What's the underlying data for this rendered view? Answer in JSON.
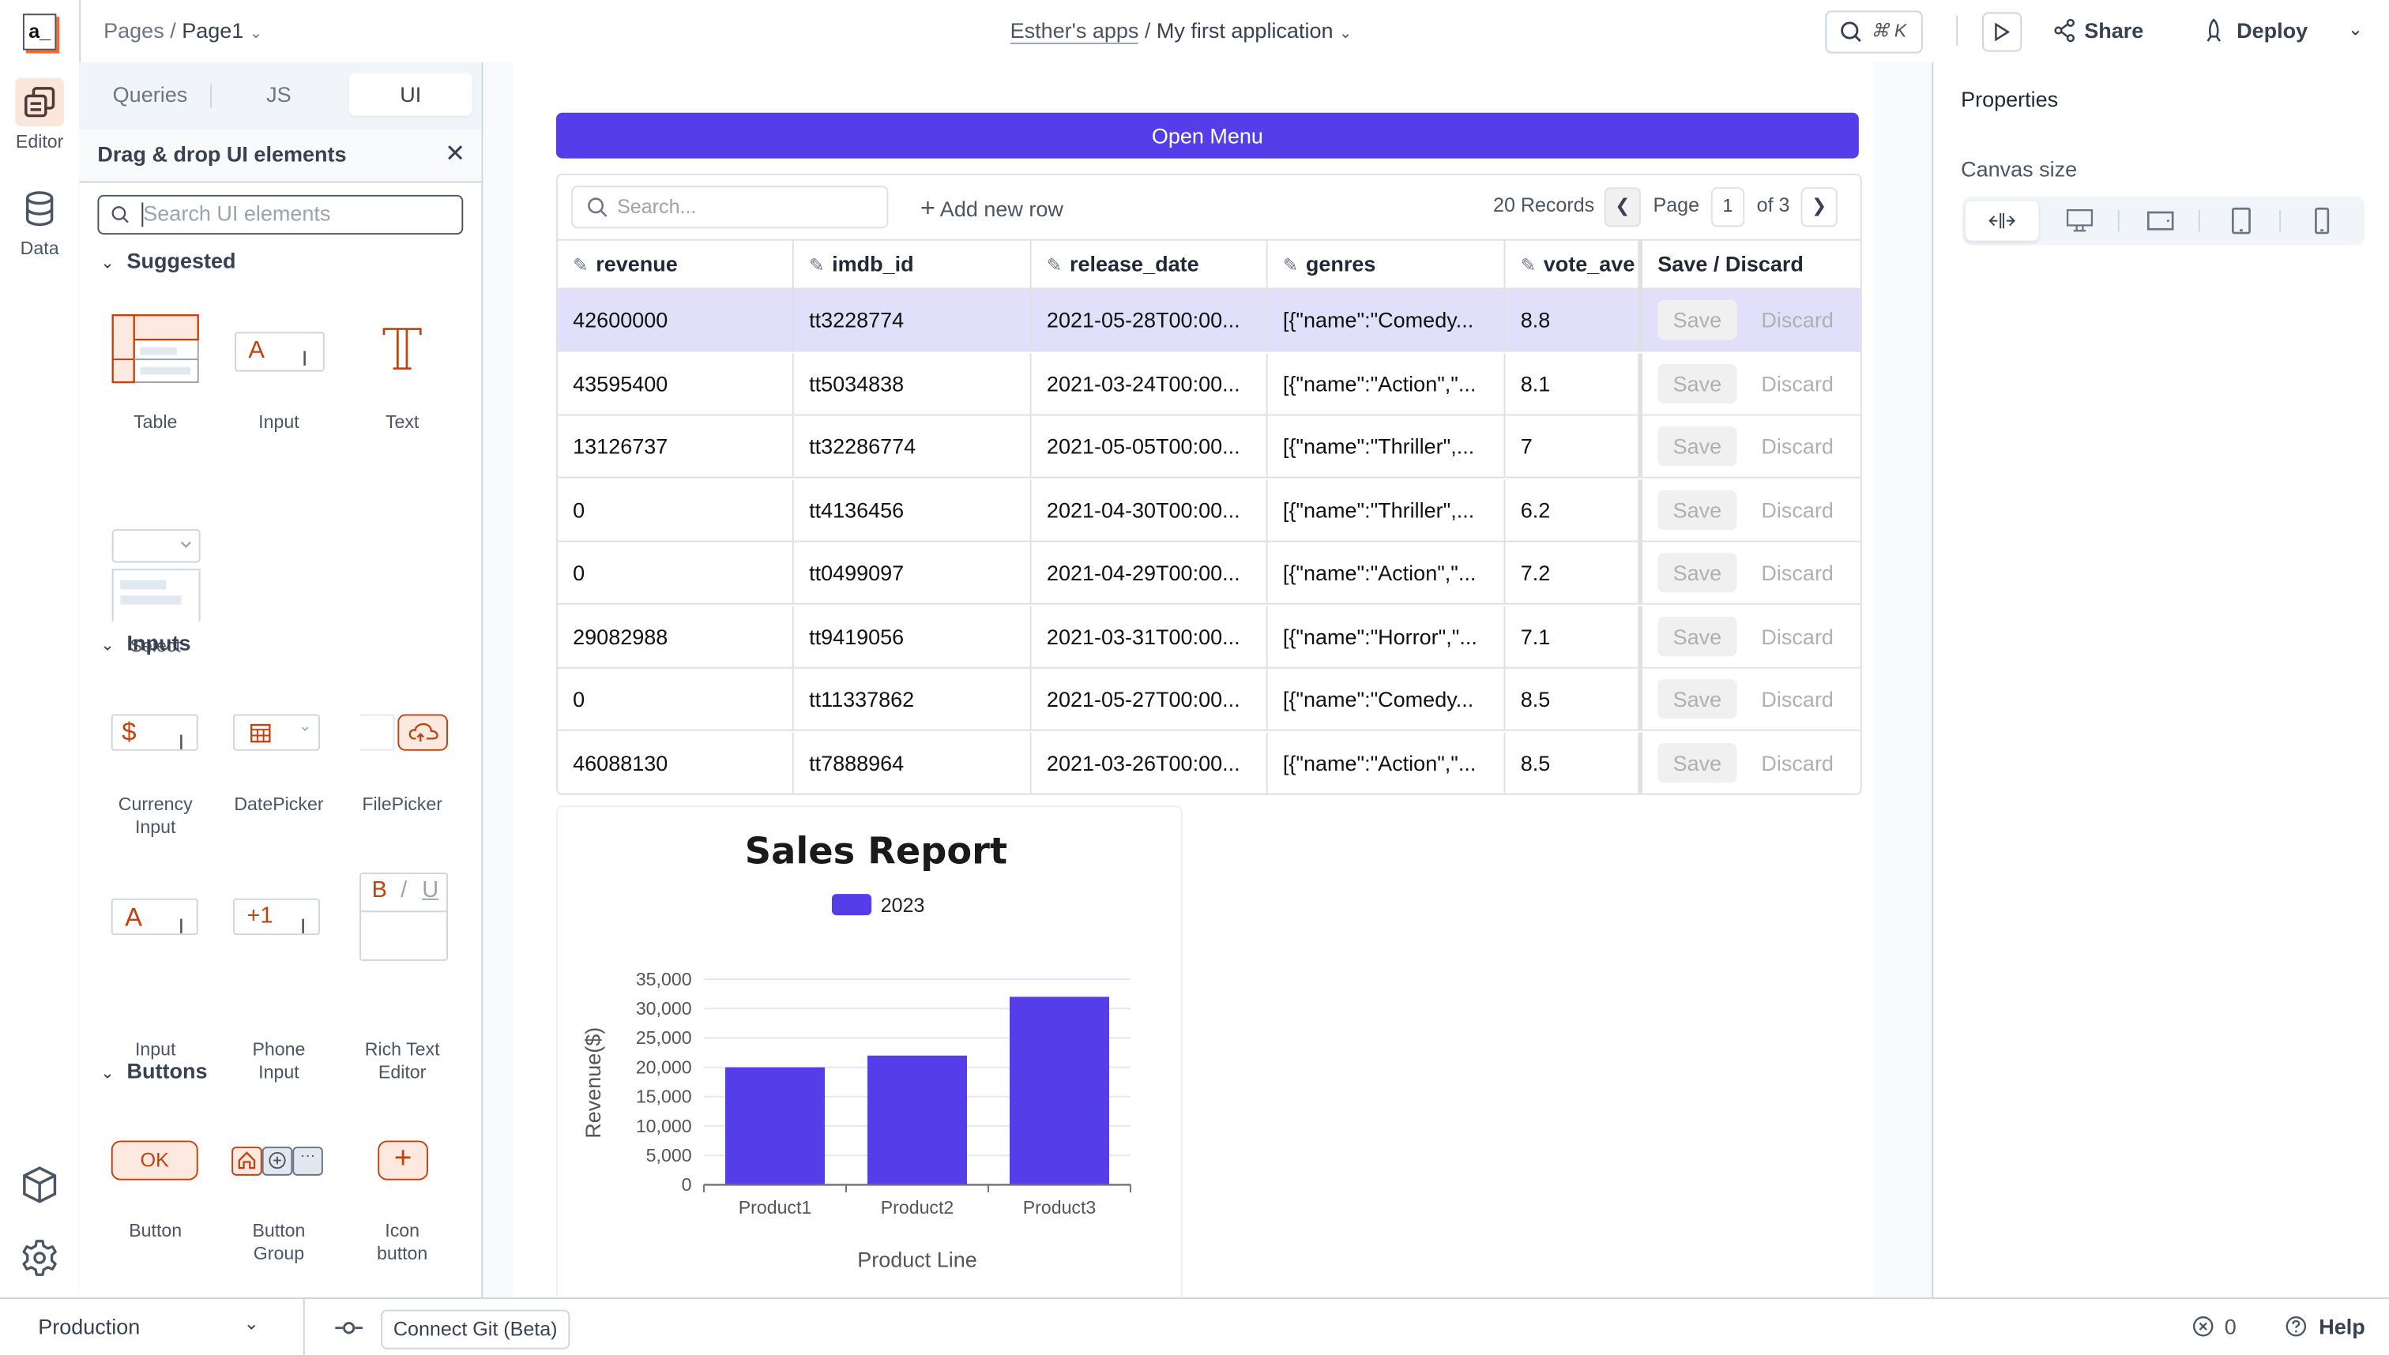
{
  "header": {
    "logo": "a_",
    "breadcrumb_root": "Pages",
    "breadcrumb_sep": "/",
    "page_name": "Page1",
    "workspace": "Esther's apps",
    "app_sep": "/",
    "app_name": "My first application",
    "search_shortcut": "⌘ K",
    "share_label": "Share",
    "deploy_label": "Deploy"
  },
  "rail": {
    "editor_label": "Editor",
    "data_label": "Data"
  },
  "explorer": {
    "tabs": [
      {
        "label": "Queries",
        "active": false
      },
      {
        "label": "JS",
        "active": false
      },
      {
        "label": "UI",
        "active": true
      }
    ],
    "panel_title": "Drag & drop UI elements",
    "search_placeholder": "Search UI elements",
    "sections": [
      {
        "title": "Suggested",
        "items": [
          "Table",
          "Input",
          "Text",
          "Select"
        ]
      },
      {
        "title": "Inputs",
        "items": [
          "Currency Input",
          "DatePicker",
          "FilePicker",
          "Input",
          "Phone Input",
          "Rich Text Editor"
        ]
      },
      {
        "title": "Buttons",
        "items": [
          "Button",
          "Button Group",
          "Icon button"
        ]
      }
    ],
    "labels": {
      "currency_1": "Currency",
      "currency_2": "Input",
      "phone_1": "Phone",
      "phone_2": "Input",
      "rte_1": "Rich Text",
      "rte_2": "Editor",
      "bgroup_1": "Button",
      "bgroup_2": "Group",
      "iconbtn_1": "Icon",
      "iconbtn_2": "button"
    },
    "glyphs": {
      "input_a": "A",
      "currency": "$",
      "phone": "+1",
      "ok": "OK",
      "rte_b": "B",
      "rte_i": "/",
      "rte_u": "U",
      "plus": "+"
    }
  },
  "canvas": {
    "open_menu_label": "Open Menu",
    "table": {
      "search_placeholder": "Search...",
      "add_row_label": "Add new row",
      "records": "20 Records",
      "page_label": "Page",
      "page": "1",
      "of_pages": "of 3",
      "columns": [
        "revenue",
        "imdb_id",
        "release_date",
        "genres",
        "vote_ave",
        "Save / Discard"
      ],
      "rows": [
        [
          "42600000",
          "tt3228774",
          "2021-05-28T00:00...",
          "[{\"name\":\"Comedy...",
          "8.8"
        ],
        [
          "43595400",
          "tt5034838",
          "2021-03-24T00:00...",
          "[{\"name\":\"Action\",\"...",
          "8.1"
        ],
        [
          "13126737",
          "tt32286774",
          "2021-05-05T00:00...",
          "[{\"name\":\"Thriller\",...",
          "7"
        ],
        [
          "0",
          "tt4136456",
          "2021-04-30T00:00...",
          "[{\"name\":\"Thriller\",...",
          "6.2"
        ],
        [
          "0",
          "tt0499097",
          "2021-04-29T00:00...",
          "[{\"name\":\"Action\",\"...",
          "7.2"
        ],
        [
          "29082988",
          "tt9419056",
          "2021-03-31T00:00...",
          "[{\"name\":\"Horror\",\"...",
          "7.1"
        ],
        [
          "0",
          "tt11337862",
          "2021-05-27T00:00...",
          "[{\"name\":\"Comedy...",
          "8.5"
        ],
        [
          "46088130",
          "tt7888964",
          "2021-03-26T00:00...",
          "[{\"name\":\"Action\",\"...",
          "8.5"
        ]
      ],
      "selected_row": 0,
      "save_label": "Save",
      "discard_label": "Discard"
    }
  },
  "chart_data": {
    "type": "bar",
    "title": "Sales Report",
    "categories": [
      "Product1",
      "Product2",
      "Product3"
    ],
    "series": [
      {
        "name": "2023",
        "values": [
          20000,
          22000,
          32000
        ],
        "color": "#553de9"
      }
    ],
    "xlabel": "Product Line",
    "ylabel": "Revenue($)",
    "ylim": [
      0,
      35000
    ],
    "yticks": [
      0,
      5000,
      10000,
      15000,
      20000,
      25000,
      30000,
      35000
    ],
    "ytick_labels": [
      "0",
      "5,000",
      "10,000",
      "15,000",
      "20,000",
      "25,000",
      "30,000",
      "35,000"
    ],
    "grid": true,
    "legend": "top-center"
  },
  "properties": {
    "title": "Properties",
    "canvas_size_label": "Canvas size",
    "canvas_sizes": [
      "fluid",
      "desktop",
      "tablet-landscape",
      "tablet",
      "mobile"
    ],
    "active_size": "fluid"
  },
  "footer": {
    "environment": "Production",
    "git_label": "Connect Git (Beta)",
    "error_count": "0",
    "help_label": "Help"
  },
  "colors": {
    "accent": "#553de9",
    "brand_orange": "#c2410c",
    "selected_row": "#e2dffb"
  }
}
